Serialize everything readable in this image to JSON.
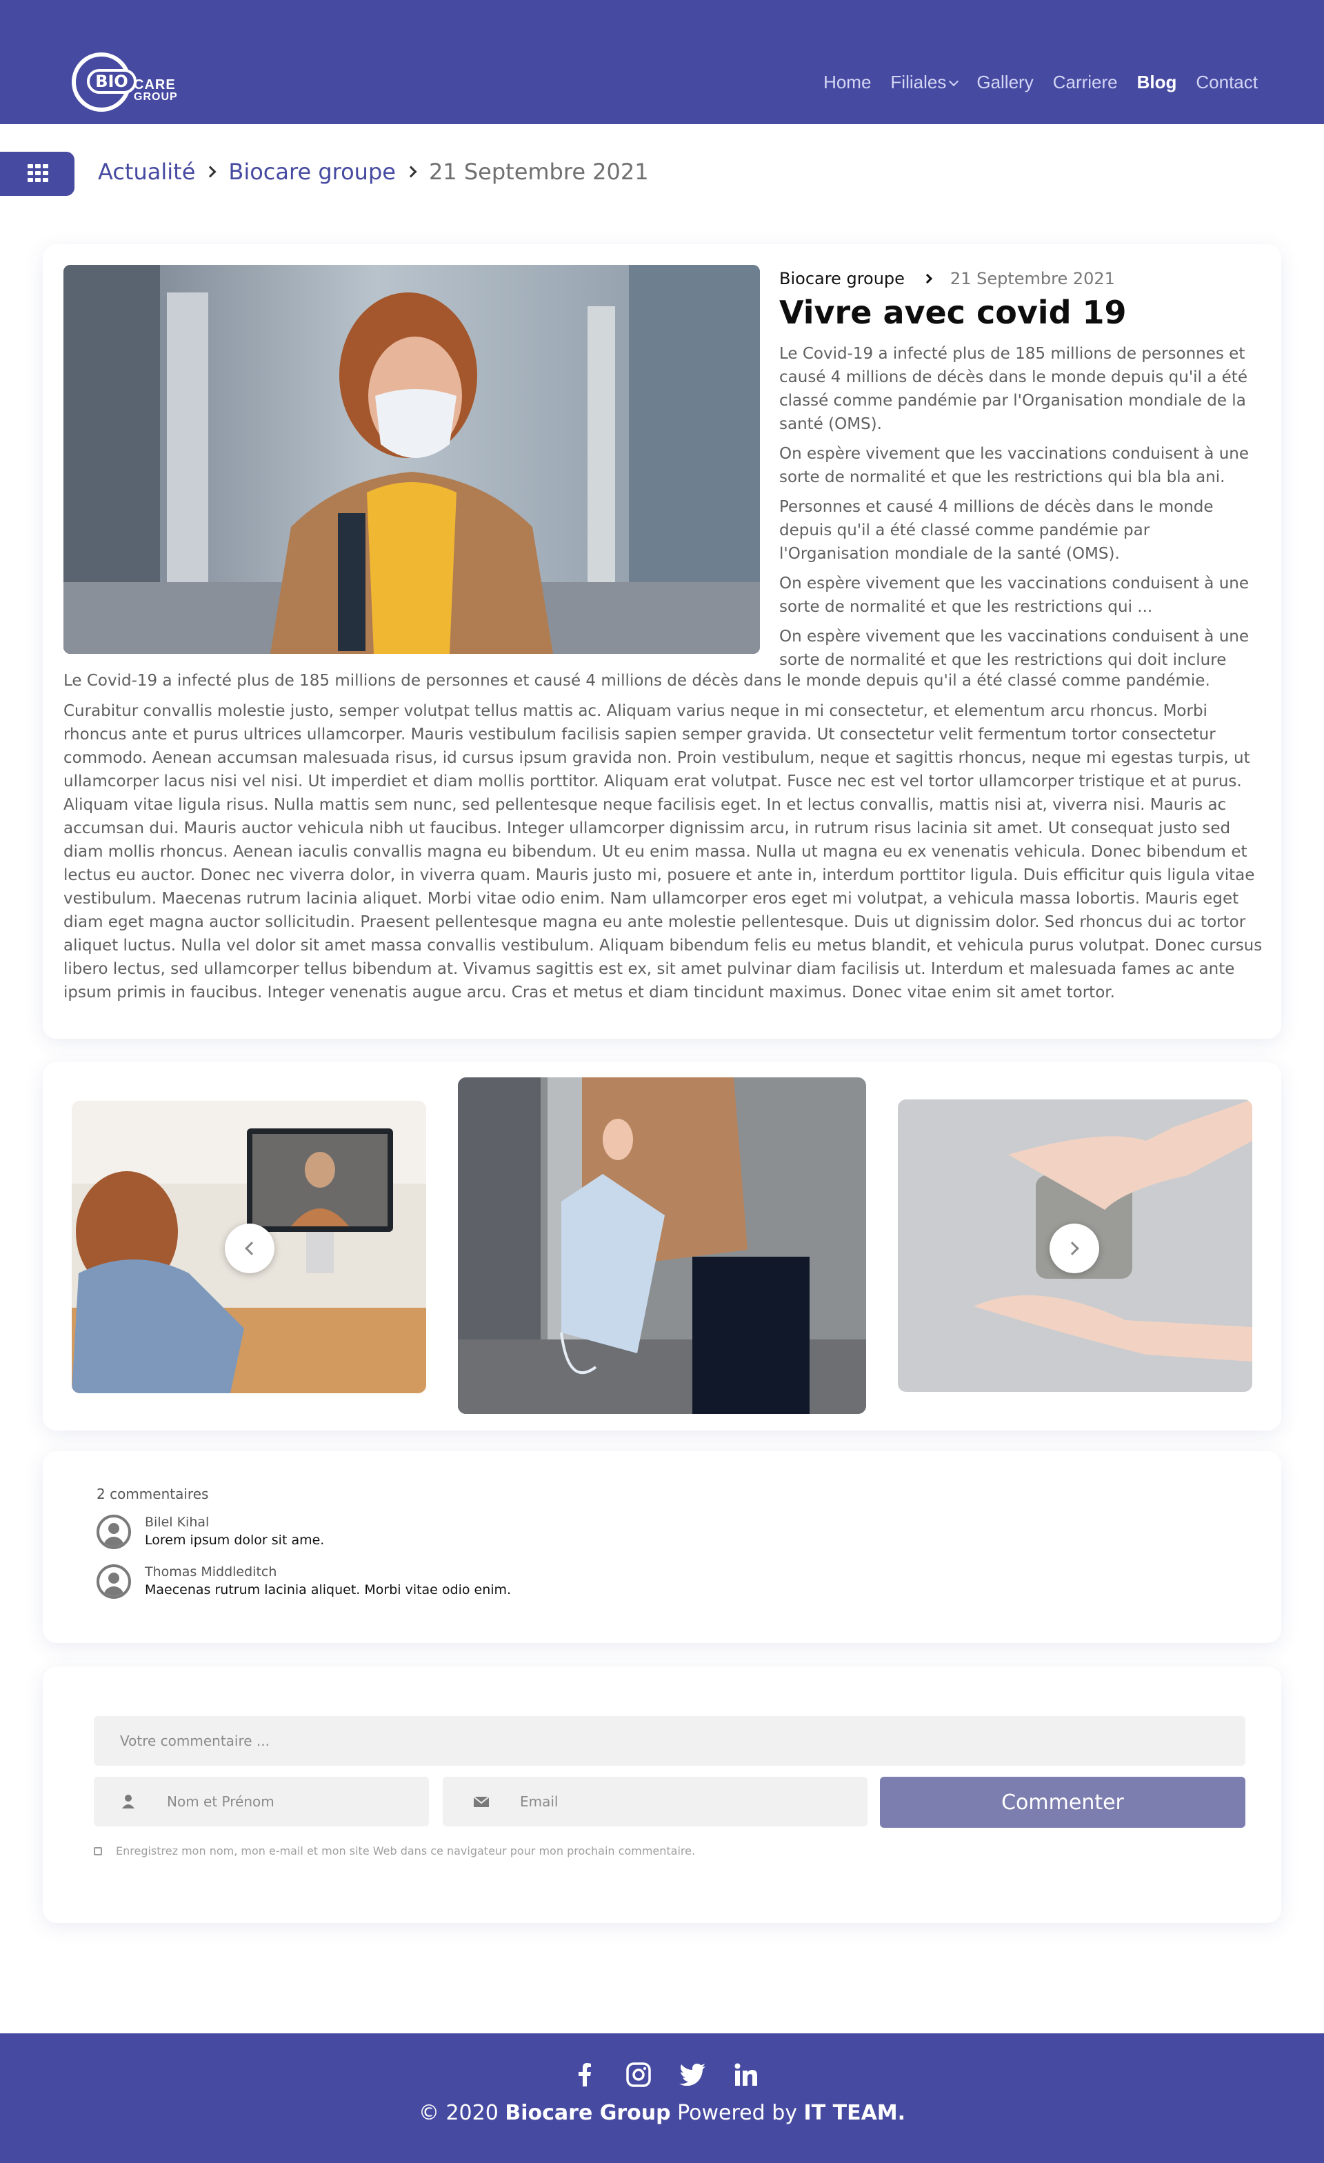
{
  "header": {
    "logo": {
      "bio": "BIO",
      "care": "CARE",
      "group": "GROUP"
    },
    "nav": [
      {
        "label": "Home"
      },
      {
        "label": "Filiales"
      },
      {
        "label": "Gallery"
      },
      {
        "label": "Carriere"
      },
      {
        "label": "Blog"
      },
      {
        "label": "Contact"
      }
    ],
    "active_item": "Blog",
    "colors": {
      "primary": "#464aa1",
      "button": "#7d7eb0"
    }
  },
  "breadcrumb": {
    "menu_icon": "grid-menu-icon",
    "items": [
      "Actualité",
      "Biocare groupe",
      "21 Septembre 2021"
    ]
  },
  "article": {
    "category": "Biocare groupe",
    "date": "21 Septembre 2021",
    "title": "Vivre avec covid 19",
    "side_paragraphs": [
      "Le Covid-19 a infecté plus de 185 millions de personnes et causé 4 millions de décès dans le monde depuis qu'il a été classé comme pandémie par l'Organisation mondiale de la santé (OMS).",
      "On espère vivement que les vaccinations conduisent à une sorte de normalité et que les restrictions qui bla bla ani.",
      "Personnes et causé 4 millions de décès dans le monde depuis qu'il a été classé comme pandémie par l'Organisation mondiale de la santé (OMS).",
      "On espère vivement que les vaccinations conduisent à une sorte de normalité et que les restrictions qui ...",
      "On espère vivement que les vaccinations conduisent à une sorte de normalité et que les restrictions qui doit inclure"
    ],
    "lead": "Le Covid-19 a infecté plus de 185 millions de personnes et causé 4 millions de décès dans le monde depuis qu'il a été classé comme pandémie.",
    "body": "Curabitur convallis molestie justo, semper volutpat tellus mattis ac. Aliquam varius neque in mi consectetur, et elementum arcu rhoncus. Morbi rhoncus ante et purus ultrices ullamcorper. Mauris vestibulum facilisis sapien semper gravida. Ut consectetur velit fermentum tortor consectetur commodo. Aenean accumsan malesuada risus, id cursus ipsum gravida non. Proin vestibulum, neque et sagittis rhoncus, neque mi egestas turpis, ut ullamcorper lacus nisi vel nisi. Ut imperdiet et diam mollis porttitor. Aliquam erat volutpat. Fusce nec est vel tortor ullamcorper tristique et at purus. Aliquam vitae ligula risus. Nulla mattis sem nunc, sed pellentesque neque facilisis eget. In et lectus convallis, mattis nisi at, viverra nisi. Mauris ac accumsan dui. Mauris auctor vehicula nibh ut faucibus. Integer ullamcorper dignissim arcu, in rutrum risus lacinia sit amet. Ut consequat justo sed diam mollis rhoncus. Aenean iaculis convallis magna eu bibendum. Ut eu enim massa. Nulla ut magna eu ex venenatis vehicula. Donec bibendum et lectus eu auctor. Donec nec viverra dolor, in viverra quam. Mauris justo mi, posuere et ante in, interdum porttitor ligula. Duis efficitur quis ligula vitae vestibulum. Maecenas rutrum lacinia aliquet. Morbi vitae odio enim. Nam ullamcorper eros eget mi volutpat, a vehicula massa lobortis. Mauris eget diam eget magna auctor sollicitudin. Praesent pellentesque magna eu ante molestie pellentesque. Duis ut dignissim dolor. Sed rhoncus dui ac tortor aliquet luctus. Nulla vel dolor sit amet massa convallis vestibulum. Aliquam bibendum felis eu metus blandit, et vehicula purus volutpat. Donec cursus libero lectus, sed ullamcorper tellus bibendum at. Vivamus sagittis est ex, sit amet pulvinar diam facilisis ut. Interdum et malesuada fames ac ante ipsum primis in faucibus. Integer venenatis augue arcu. Cras et metus et diam tincidunt maximus. Donec vitae enim sit amet tortor."
  },
  "gallery": {
    "prev_icon": "chevron-left-icon",
    "next_icon": "chevron-right-icon"
  },
  "comments": {
    "count_label": "2 commentaires",
    "items": [
      {
        "name": "Bilel Kihal",
        "text": "Lorem ipsum dolor sit ame."
      },
      {
        "name": "Thomas Middleditch",
        "text": "Maecenas rutrum lacinia aliquet. Morbi vitae odio enim."
      }
    ]
  },
  "form": {
    "comment_placeholder": "Votre commentaire ...",
    "name_placeholder": "Nom et Prénom",
    "email_placeholder": "Email",
    "submit_label": "Commenter",
    "remember_label": "Enregistrez mon nom, mon e-mail et mon site Web dans ce navigateur pour mon prochain commentaire."
  },
  "footer": {
    "socials": [
      "facebook-icon",
      "instagram-icon",
      "twitter-icon",
      "linkedin-icon"
    ],
    "copy_prefix": "© 2020 ",
    "copy_brand": "Biocare Group",
    "copy_mid": " Powered by ",
    "copy_team": "IT TEAM."
  }
}
